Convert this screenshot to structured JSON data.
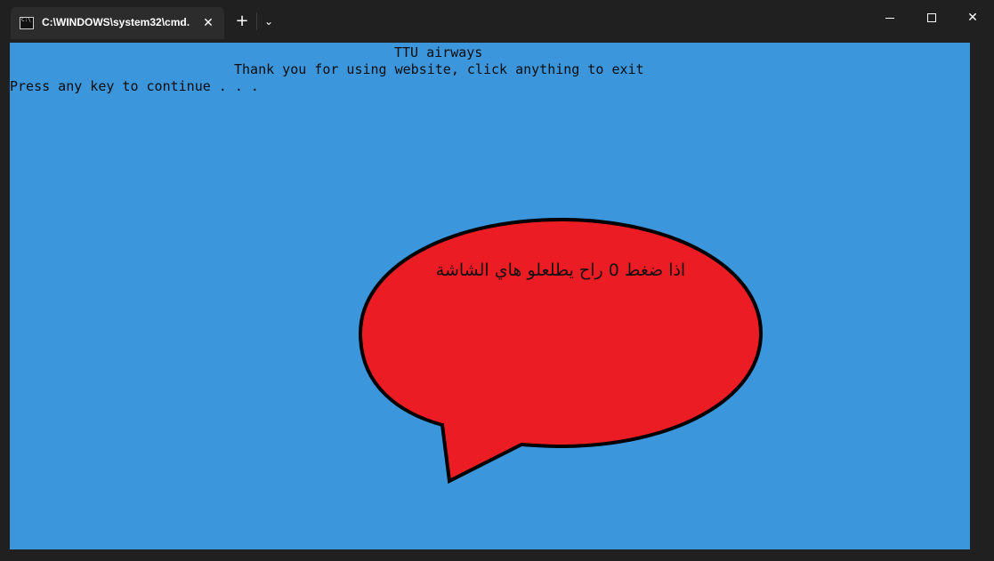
{
  "window": {
    "tab_title": "C:\\WINDOWS\\system32\\cmd.",
    "tab_close_glyph": "✕",
    "new_tab_glyph": "+",
    "dropdown_glyph": "⌄",
    "close_glyph": "✕"
  },
  "console": {
    "background": "#3c96dc",
    "lines": [
      "TTU airways",
      "Thank you for using website, click anything to exit",
      "Press any key to continue . . ."
    ]
  },
  "annotation": {
    "text": "اذا ضغط 0 راح يطلعلو هاي الشاشة",
    "fill": "#ec1c24",
    "stroke": "#000000"
  }
}
